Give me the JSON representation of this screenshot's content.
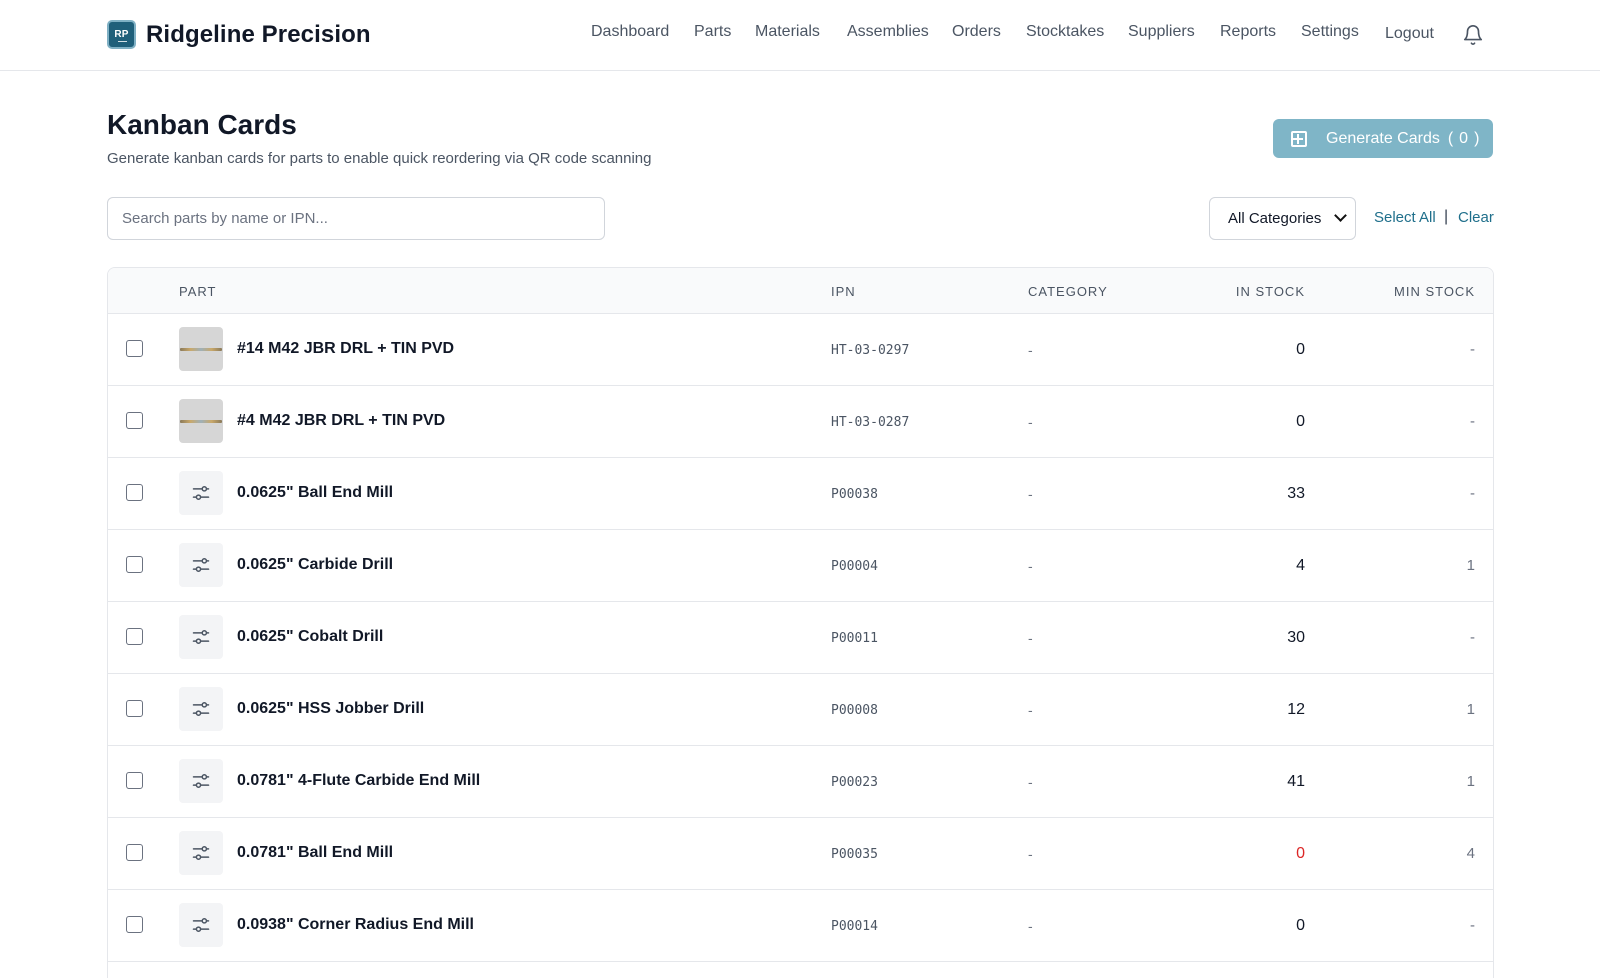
{
  "brand": {
    "logo_text": "RP",
    "name": "Ridgeline Precision"
  },
  "nav": [
    "Dashboard",
    "Parts",
    "Materials",
    "Assemblies",
    "Orders",
    "Stocktakes",
    "Suppliers",
    "Reports",
    "Settings",
    "Logout"
  ],
  "page": {
    "title": "Kanban Cards",
    "subtitle": "Generate kanban cards for parts to enable quick reordering via QR code scanning",
    "generate_label": "Generate Cards",
    "paren_open": "(",
    "paren_close": ")",
    "selected_count": "0"
  },
  "filters": {
    "search_placeholder": "Search parts by name or IPN...",
    "category_selected": "All Categories",
    "select_all": "Select All",
    "separator": "|",
    "clear": "Clear"
  },
  "table": {
    "headers": {
      "part": "PART",
      "ipn": "IPN",
      "category": "CATEGORY",
      "in_stock": "IN STOCK",
      "min_stock": "MIN STOCK"
    },
    "rows": [
      {
        "name": "#14 M42 JBR DRL + TIN PVD",
        "ipn": "HT-03-0297",
        "category": "-",
        "in_stock": "0",
        "min_stock": "-",
        "thumb": "photo",
        "low": false
      },
      {
        "name": "#4 M42 JBR DRL + TIN PVD",
        "ipn": "HT-03-0287",
        "category": "-",
        "in_stock": "0",
        "min_stock": "-",
        "thumb": "photo",
        "low": false
      },
      {
        "name": "0.0625\" Ball End Mill",
        "ipn": "P00038",
        "category": "-",
        "in_stock": "33",
        "min_stock": "-",
        "thumb": "icon",
        "low": false
      },
      {
        "name": "0.0625\" Carbide Drill",
        "ipn": "P00004",
        "category": "-",
        "in_stock": "4",
        "min_stock": "1",
        "thumb": "icon",
        "low": false
      },
      {
        "name": "0.0625\" Cobalt Drill",
        "ipn": "P00011",
        "category": "-",
        "in_stock": "30",
        "min_stock": "-",
        "thumb": "icon",
        "low": false
      },
      {
        "name": "0.0625\" HSS Jobber Drill",
        "ipn": "P00008",
        "category": "-",
        "in_stock": "12",
        "min_stock": "1",
        "thumb": "icon",
        "low": false
      },
      {
        "name": "0.0781\" 4-Flute Carbide End Mill",
        "ipn": "P00023",
        "category": "-",
        "in_stock": "41",
        "min_stock": "1",
        "thumb": "icon",
        "low": false
      },
      {
        "name": "0.0781\" Ball End Mill",
        "ipn": "P00035",
        "category": "-",
        "in_stock": "0",
        "min_stock": "4",
        "thumb": "icon",
        "low": true
      },
      {
        "name": "0.0938\" Corner Radius End Mill",
        "ipn": "P00014",
        "category": "-",
        "in_stock": "0",
        "min_stock": "-",
        "thumb": "icon",
        "low": false
      }
    ]
  },
  "colors": {
    "accent": "#1f6f8b",
    "button_disabled": "#7fb5c7",
    "low_stock": "#dc2626"
  },
  "icons": {
    "brand": "rp-logo-icon",
    "notifications": "bell-icon",
    "generate": "plus-square-icon",
    "part_placeholder": "sliders-icon"
  }
}
